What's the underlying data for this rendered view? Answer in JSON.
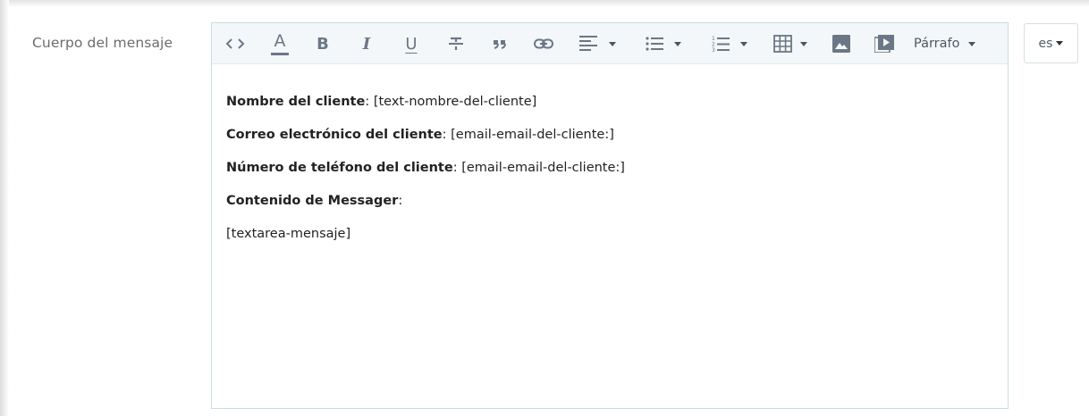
{
  "field": {
    "label": "Cuerpo del mensaje"
  },
  "toolbar": {
    "buttons": [
      {
        "name": "code-view-icon"
      },
      {
        "name": "font-color-icon",
        "glyph": "A"
      },
      {
        "name": "bold-icon",
        "glyph": "B"
      },
      {
        "name": "italic-icon",
        "glyph": "I"
      },
      {
        "name": "underline-icon",
        "glyph": "U"
      },
      {
        "name": "strikethrough-icon"
      },
      {
        "name": "blockquote-icon"
      },
      {
        "name": "link-icon"
      },
      {
        "name": "align-left-icon",
        "dropdown": true
      },
      {
        "name": "bulleted-list-icon",
        "dropdown": true
      },
      {
        "name": "numbered-list-icon",
        "dropdown": true
      },
      {
        "name": "table-icon",
        "dropdown": true
      },
      {
        "name": "image-icon"
      },
      {
        "name": "video-icon"
      }
    ],
    "paragraph_format": "Párrafo"
  },
  "editor": {
    "lines": [
      {
        "label": "Nombre del cliente",
        "sep": ": ",
        "value": "[text-nombre-del-cliente]"
      },
      {
        "label": "Correo electrónico del cliente",
        "sep": ": ",
        "value": "[email-email-del-cliente:]"
      },
      {
        "label": "Número de teléfono del cliente",
        "sep": ": ",
        "value": "[email-email-del-cliente:]"
      },
      {
        "label": "Contenido de Messager",
        "sep": ":",
        "value": ""
      }
    ],
    "body_text": "[textarea-mensaje]"
  },
  "language": {
    "selected": "es"
  },
  "colors": {
    "toolbar_bg": "#f4f7f9",
    "editor_border": "#c8dce3",
    "icon": "#6b7785",
    "text": "#222222",
    "label": "#6c6c6c"
  }
}
